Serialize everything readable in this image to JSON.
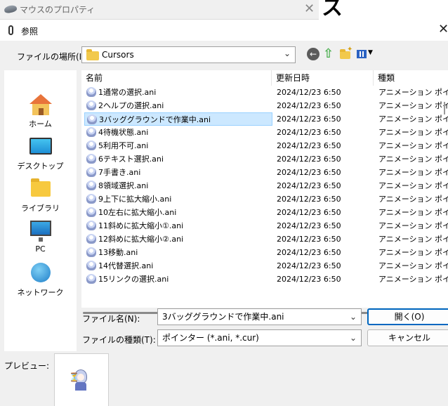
{
  "background_window": {
    "title": "マウスのプロパティ",
    "close": "✕",
    "big_char": "ス"
  },
  "dialog": {
    "title": "参照",
    "close": "✕",
    "lookin": {
      "label": "ファイルの場所(I):",
      "value": "Cursors"
    },
    "places": [
      {
        "label": "ホーム"
      },
      {
        "label": "デスクトップ"
      },
      {
        "label": "ライブラリ"
      },
      {
        "label": "PC"
      },
      {
        "label": "ネットワーク"
      }
    ],
    "columns": {
      "name": "名前",
      "date": "更新日時",
      "type": "種類"
    },
    "files": [
      {
        "name": "1通常の選択.ani",
        "date": "2024/12/23 6:50",
        "type": "アニメーション ポインター"
      },
      {
        "name": "2ヘルプの選択.ani",
        "date": "2024/12/23 6:50",
        "type": "アニメーション ポインター"
      },
      {
        "name": "3バッググラウンドで作業中.ani",
        "date": "2024/12/23 6:50",
        "type": "アニメーション ポインター"
      },
      {
        "name": "4待機状態.ani",
        "date": "2024/12/23 6:50",
        "type": "アニメーション ポインター"
      },
      {
        "name": "5利用不可.ani",
        "date": "2024/12/23 6:50",
        "type": "アニメーション ポインター"
      },
      {
        "name": "6テキスト選択.ani",
        "date": "2024/12/23 6:50",
        "type": "アニメーション ポインター"
      },
      {
        "name": "7手書き.ani",
        "date": "2024/12/23 6:50",
        "type": "アニメーション ポインター"
      },
      {
        "name": "8領域選択.ani",
        "date": "2024/12/23 6:50",
        "type": "アニメーション ポインター"
      },
      {
        "name": "9上下に拡大縮小.ani",
        "date": "2024/12/23 6:50",
        "type": "アニメーション ポインター"
      },
      {
        "name": "10左右に拡大縮小.ani",
        "date": "2024/12/23 6:50",
        "type": "アニメーション ポインター"
      },
      {
        "name": "11斜めに拡大縮小①.ani",
        "date": "2024/12/23 6:50",
        "type": "アニメーション ポインター"
      },
      {
        "name": "12斜めに拡大縮小②.ani",
        "date": "2024/12/23 6:50",
        "type": "アニメーション ポインター"
      },
      {
        "name": "13移動.ani",
        "date": "2024/12/23 6:50",
        "type": "アニメーション ポインター"
      },
      {
        "name": "14代替選択.ani",
        "date": "2024/12/23 6:50",
        "type": "アニメーション ポインター"
      },
      {
        "name": "15リンクの選択.ani",
        "date": "2024/12/23 6:50",
        "type": "アニメーション ポインター"
      }
    ],
    "selected_index": 2,
    "filename": {
      "label": "ファイル名(N):",
      "value": "3バッググラウンドで作業中.ani"
    },
    "filetype": {
      "label": "ファイルの種類(T):",
      "value": "ポインター (*.ani, *.cur)"
    },
    "open_label": "開く(O)",
    "cancel_label": "キャンセル",
    "preview_label": "プレビュー:"
  },
  "colors": {
    "selection_bg": "#cce8ff",
    "accent": "#0067c0"
  }
}
